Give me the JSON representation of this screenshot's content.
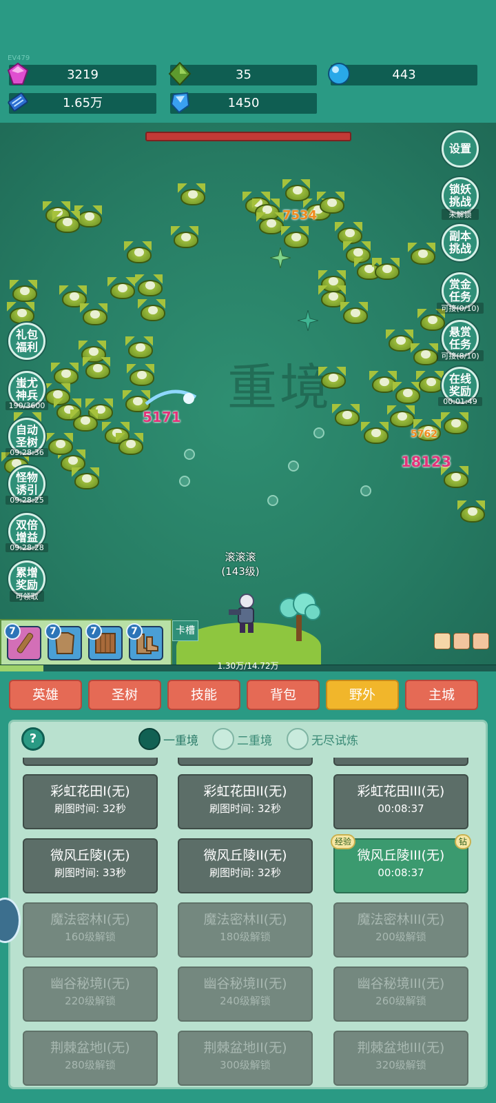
{
  "version": "EV479",
  "resources": [
    {
      "icon": "pink-gem-icon",
      "value": "3219"
    },
    {
      "icon": "green-crystal-icon",
      "value": "35"
    },
    {
      "icon": "blue-orb-icon",
      "value": "443"
    },
    {
      "icon": "blue-book-icon",
      "value": "1.65万"
    },
    {
      "icon": "blue-shard-icon",
      "value": "1450"
    }
  ],
  "battle": {
    "watermark": "重境",
    "damage": [
      "7534",
      "5171",
      "18123",
      "5762"
    ],
    "hero_name": "滚滚滚",
    "hero_level": "(143级)"
  },
  "right_buttons": [
    {
      "label": "设置",
      "sub": ""
    },
    {
      "label": "锁妖挑战",
      "sub": "未解锁"
    },
    {
      "label": "副本挑战",
      "sub": ""
    },
    {
      "label": "赏金任务",
      "sub": "可接(0/10)"
    },
    {
      "label": "悬赏任务",
      "sub": "可接(8/10)"
    },
    {
      "label": "在线奖励",
      "sub": "00:01:49"
    }
  ],
  "left_buttons": [
    {
      "label": "礼包福利",
      "sub": ""
    },
    {
      "label": "蚩尤神兵",
      "sub": "190/3600"
    },
    {
      "label": "自动圣树",
      "sub": "09:28:36"
    },
    {
      "label": "怪物诱引",
      "sub": "09:28:25"
    },
    {
      "label": "双倍增益",
      "sub": "09:28:28"
    },
    {
      "label": "累增奖励",
      "sub": "可领取"
    }
  ],
  "equip_slots": [
    {
      "level": "7",
      "icon": "wooden-sword-icon",
      "color": "#d36fb7"
    },
    {
      "level": "7",
      "icon": "leather-armor-icon",
      "color": "#4a9fd6"
    },
    {
      "level": "7",
      "icon": "wooden-shield-icon",
      "color": "#4a9fd6"
    },
    {
      "level": "7",
      "icon": "leather-boots-icon",
      "color": "#4a9fd6"
    }
  ],
  "card_slot_label": "卡槽",
  "exp": {
    "text": "1.30万/14.72万",
    "fraction": 0.088
  },
  "tabs": [
    {
      "label": "英雄",
      "active": false
    },
    {
      "label": "圣树",
      "active": false
    },
    {
      "label": "技能",
      "active": false
    },
    {
      "label": "背包",
      "active": false
    },
    {
      "label": "野外",
      "active": true
    },
    {
      "label": "主城",
      "active": false
    }
  ],
  "panel": {
    "help": "?",
    "realms": [
      {
        "label": "一重境",
        "selected": true
      },
      {
        "label": "二重境",
        "selected": false
      },
      {
        "label": "无尽试炼",
        "selected": false
      }
    ],
    "maps": [
      {
        "title": "彩虹花田I(无)",
        "sub": "刷图时间: 32秒",
        "state": "normal"
      },
      {
        "title": "彩虹花田II(无)",
        "sub": "刷图时间: 32秒",
        "state": "normal"
      },
      {
        "title": "彩虹花田III(无)",
        "sub": "00:08:37",
        "state": "normal"
      },
      {
        "title": "微风丘陵I(无)",
        "sub": "刷图时间: 33秒",
        "state": "normal"
      },
      {
        "title": "微风丘陵II(无)",
        "sub": "刷图时间: 32秒",
        "state": "normal"
      },
      {
        "title": "微风丘陵III(无)",
        "sub": "00:08:37",
        "state": "selected",
        "badge_left": "经验",
        "badge_right": "钻"
      },
      {
        "title": "魔法密林I(无)",
        "sub": "160级解锁",
        "state": "locked"
      },
      {
        "title": "魔法密林II(无)",
        "sub": "180级解锁",
        "state": "locked"
      },
      {
        "title": "魔法密林III(无)",
        "sub": "200级解锁",
        "state": "locked"
      },
      {
        "title": "幽谷秘境I(无)",
        "sub": "220级解锁",
        "state": "locked"
      },
      {
        "title": "幽谷秘境II(无)",
        "sub": "240级解锁",
        "state": "locked"
      },
      {
        "title": "幽谷秘境III(无)",
        "sub": "260级解锁",
        "state": "locked"
      },
      {
        "title": "荆棘盆地I(无)",
        "sub": "280级解锁",
        "state": "locked"
      },
      {
        "title": "荆棘盆地II(无)",
        "sub": "300级解锁",
        "state": "locked"
      },
      {
        "title": "荆棘盆地III(无)",
        "sub": "320级解锁",
        "state": "locked"
      }
    ]
  }
}
